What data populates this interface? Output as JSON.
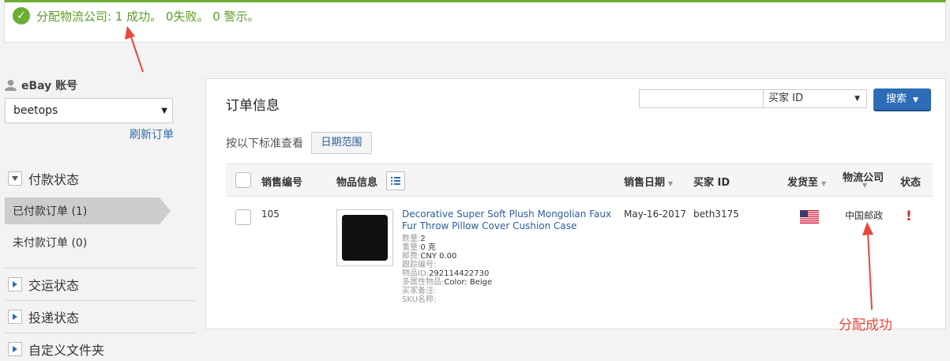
{
  "banner": {
    "message": "分配物流公司: 1 成功。 0失败。 0 警示。",
    "check_icon": "check-circle-icon"
  },
  "sidebar": {
    "account_label": "eBay 账号",
    "account_value": "beetops",
    "refresh_label": "刷新订单",
    "payment_section": "付款状态",
    "paid_label": "已付款订单 (1)",
    "unpaid_label": "未付款订单 (0)",
    "shipping_section": "交运状态",
    "delivery_section": "投递状态",
    "custom_section": "自定义文件夹"
  },
  "main": {
    "title": "订单信息",
    "search": {
      "placeholder": "",
      "type_value": "买家 ID",
      "button_label": "搜索"
    },
    "filter_label": "按以下标准查看",
    "date_range_label": "日期范围",
    "columns": {
      "sale_no": "销售编号",
      "item_info": "物品信息",
      "sale_date": "销售日期",
      "buyer_id": "买家 ID",
      "ship_to": "发货至",
      "carrier": "物流公司",
      "status": "状态"
    },
    "order": {
      "sale_no": "105",
      "item_title": "Decorative Super Soft Plush Mongolian Faux Fur Throw Pillow Cover Cushion Case",
      "qty_label": "数量:",
      "qty_value": "2",
      "weight_label": "重量:",
      "weight_value": "0 克",
      "postage_label": "邮费:",
      "postage_value": "CNY 0.00",
      "tracking_label": "跟踪编号:",
      "tracking_value": "",
      "item_id_label": "物品ID:",
      "item_id_value": "292114422730",
      "variation_label": "多属性物品:",
      "variation_value": "Color: Beige",
      "buyer_note_label": "买家备注:",
      "buyer_note_value": "",
      "sku_label": "SKU名称:",
      "sku_value": "",
      "sale_date": "May-16-2017",
      "buyer_id": "beth3175",
      "ship_to_flag": "us-flag-icon",
      "carrier": "中国邮政",
      "status_icon": "exclamation-icon"
    }
  },
  "annotation": {
    "text": "分配成功",
    "color": "#e8473b"
  },
  "colors": {
    "success": "#6aae32",
    "link": "#2b5d9c",
    "primary": "#2d6db5",
    "alert": "#d62b2b"
  }
}
